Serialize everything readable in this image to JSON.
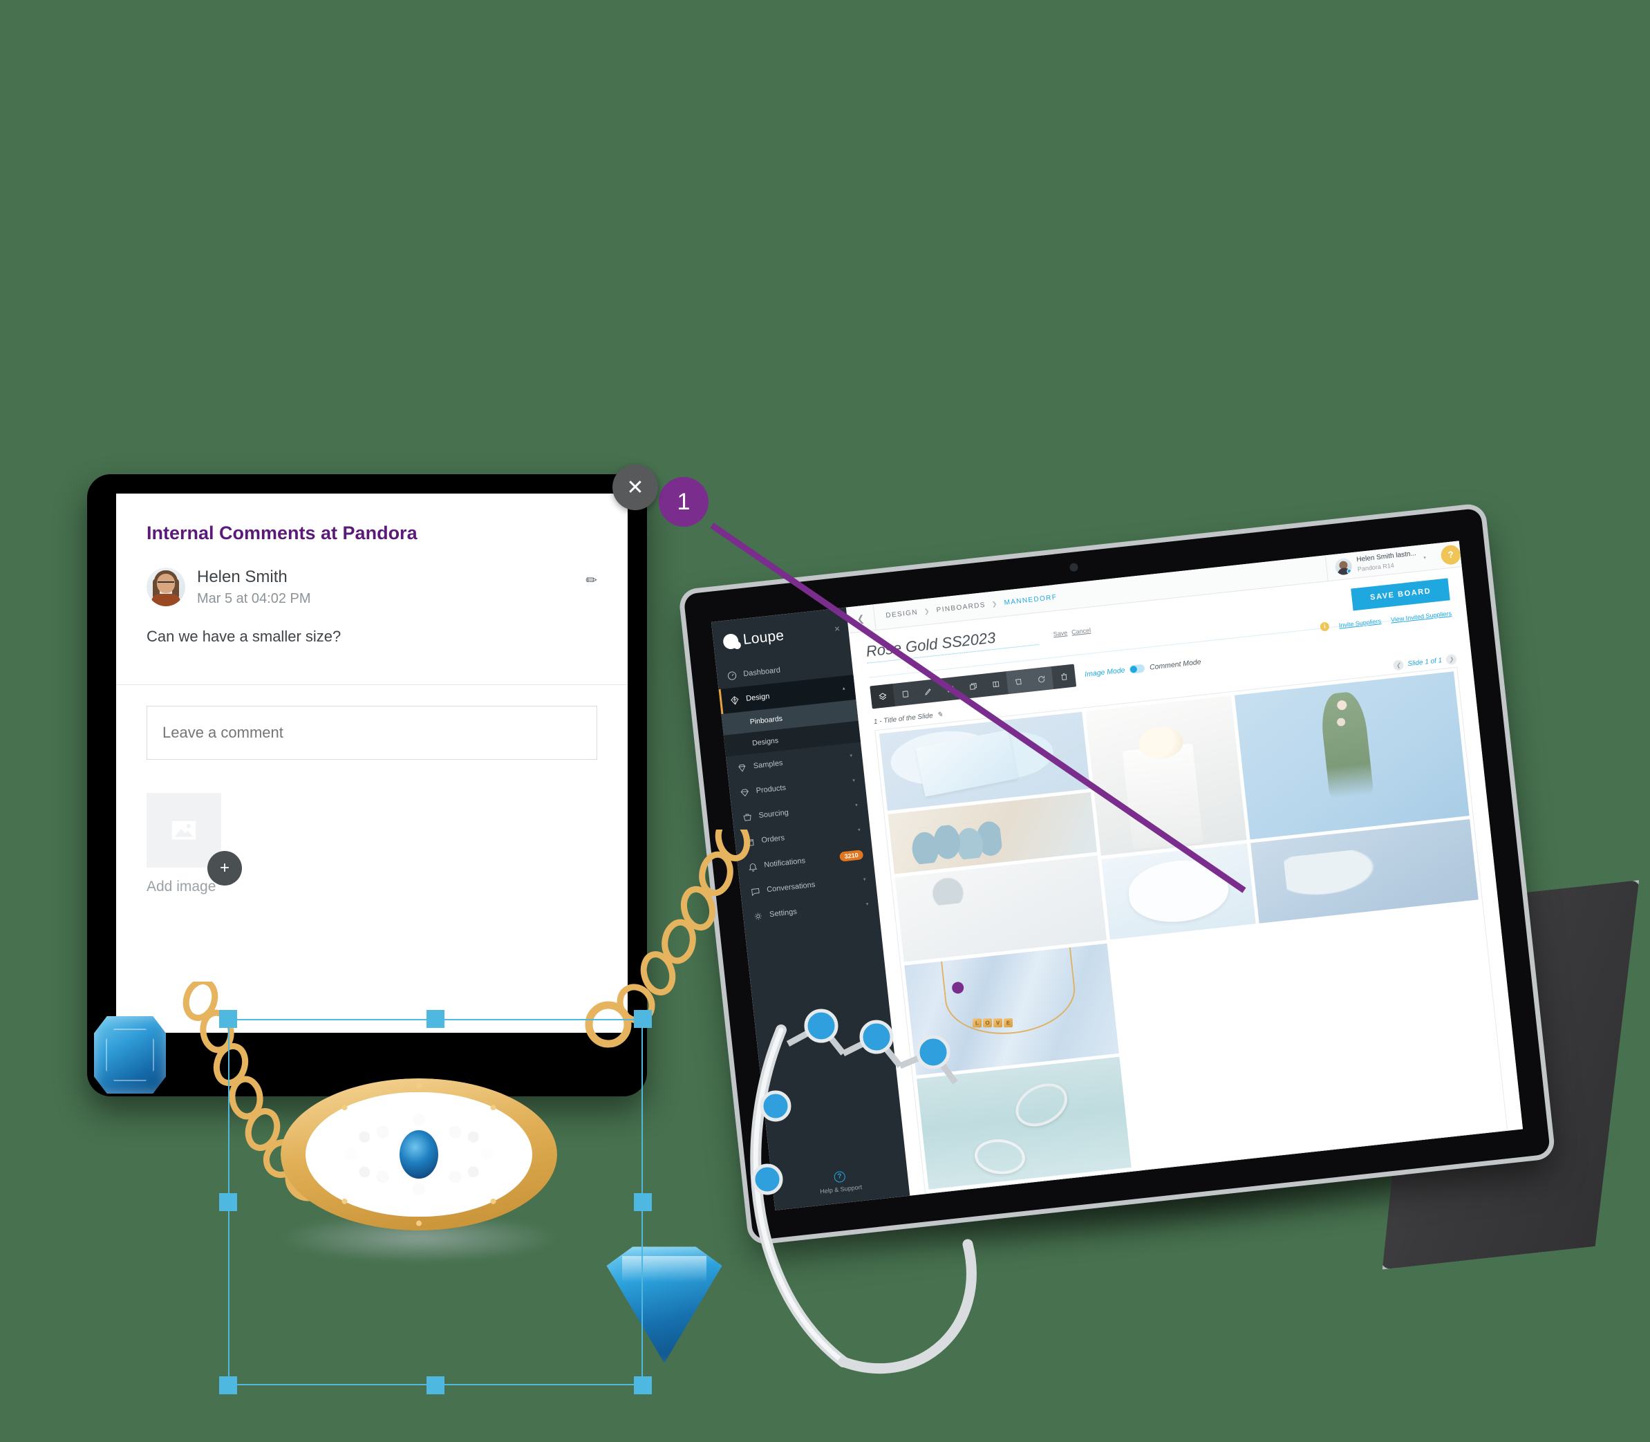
{
  "background_color": "#47714f",
  "annotation": {
    "marker_number": "1",
    "marker_color": "#7b2d8e",
    "close_icon": "close-icon"
  },
  "comment_panel": {
    "title": "Internal Comments at Pandora",
    "comment": {
      "author": "Helen Smith",
      "timestamp": "Mar 5 at 04:02 PM",
      "text": "Can we have a smaller size?",
      "edit_icon": "pencil-icon"
    },
    "input_placeholder": "Leave a comment",
    "input_value": "",
    "add_image_label": "Add image",
    "add_button_label": "+",
    "image_placeholder_icon": "image-icon"
  },
  "app": {
    "brand": "Loupe",
    "brand_close": "×",
    "sidebar": {
      "items": [
        {
          "label": "Dashboard",
          "icon": "gauge-icon",
          "active": false,
          "caret": ""
        },
        {
          "label": "Design",
          "icon": "diamond-icon",
          "active": true,
          "caret": "▴"
        },
        {
          "label": "Samples",
          "icon": "gem-ring-icon",
          "active": false,
          "caret": "▾"
        },
        {
          "label": "Products",
          "icon": "gem-icon",
          "active": false,
          "caret": "▾"
        },
        {
          "label": "Sourcing",
          "icon": "basket-icon",
          "active": false,
          "caret": "▾"
        },
        {
          "label": "Orders",
          "icon": "box-icon",
          "active": false,
          "caret": "▾"
        },
        {
          "label": "Notifications",
          "icon": "bell-icon",
          "active": false,
          "caret": "",
          "badge": "3210"
        },
        {
          "label": "Conversations",
          "icon": "chat-icon",
          "active": false,
          "caret": "▾"
        },
        {
          "label": "Settings",
          "icon": "gear-icon",
          "active": false,
          "caret": "▾"
        }
      ],
      "sub_items": [
        {
          "label": "Pinboards",
          "selected": true
        },
        {
          "label": "Designs",
          "selected": false
        }
      ],
      "help_support": "Help & Support",
      "help_icon": "question-icon"
    },
    "topbar": {
      "back_icon": "chevron-left-icon",
      "breadcrumb": [
        "DESIGN",
        "PINBOARDS",
        "MANNEDORF"
      ],
      "breadcrumb_separator": "❯",
      "user_name": "Helen Smith lastn...",
      "user_org": "Pandora R14",
      "user_caret": "▾",
      "help_badge": "?"
    },
    "board": {
      "title": "Rose Gold SS2023",
      "save_link": "Save",
      "cancel_link": "Cancel",
      "save_board_button": "SAVE BOARD",
      "invite_suppliers": "Invite Suppliers",
      "view_invited_suppliers": "View Invited Suppliers",
      "invite_icon": "info-icon",
      "image_mode": "Image Mode",
      "comment_mode": "Comment Mode",
      "active_mode": "Image Mode",
      "slide_label": "1 - Title of the Slide",
      "slide_edit_icon": "pencil-icon",
      "slide_counter": "Slide 1 of 1",
      "slide_prev_icon": "chevron-left-icon",
      "slide_next_icon": "chevron-right-icon",
      "toolbar_icons": [
        "layers-icon",
        "crop-icon",
        "pen-icon",
        "text-box-icon",
        "duplicate-icon",
        "align-icon",
        "shape-icon",
        "rotate-icon",
        "trash-icon"
      ],
      "necklace_letters": [
        "L",
        "O",
        "V",
        "E"
      ]
    }
  },
  "colors": {
    "accent_cyan": "#1fa8e0",
    "accent_purple": "#5b1a78",
    "marker_purple": "#7b2d8e",
    "badge_orange": "#e0761f",
    "help_yellow": "#f0c557",
    "sidebar_bg": "#242d33",
    "selection_blue": "#4fb8e0"
  }
}
